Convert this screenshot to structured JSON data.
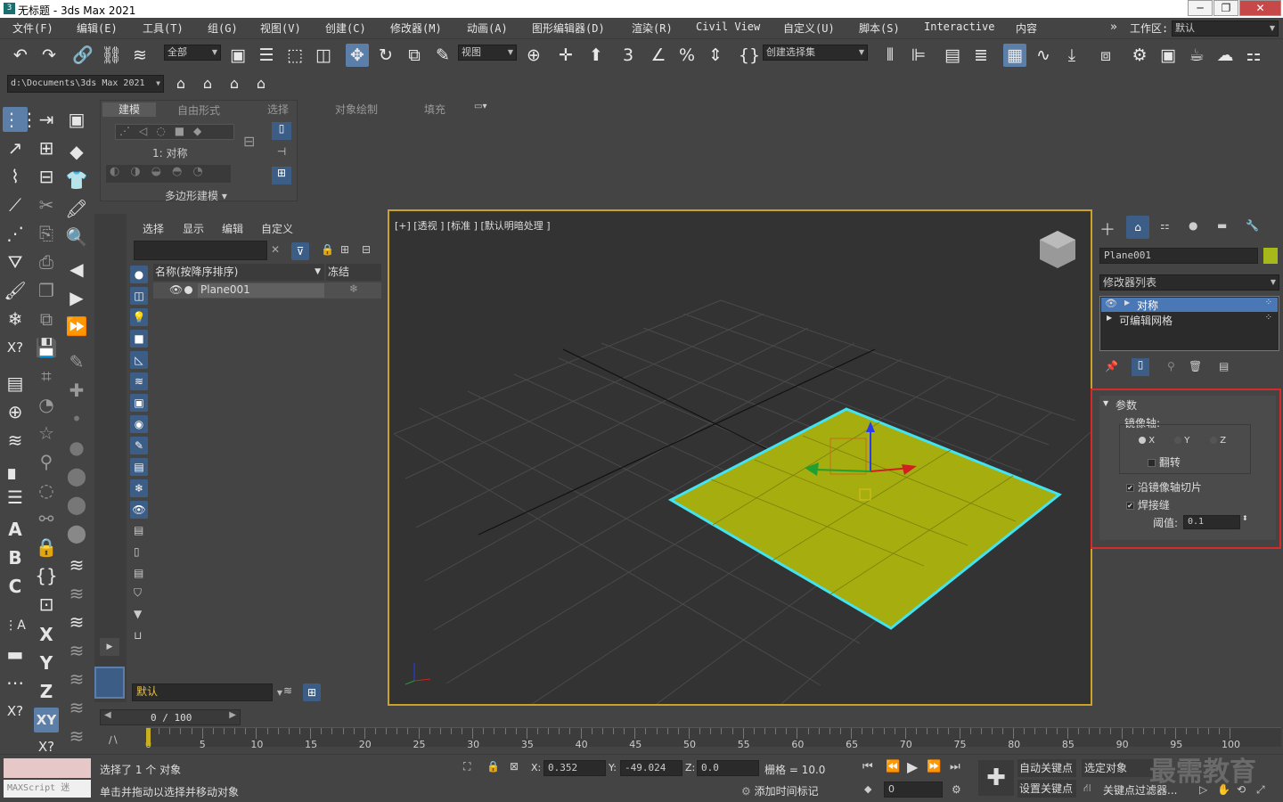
{
  "window": {
    "app_icon": "3dsmax-logo-icon",
    "title": "无标题 - 3ds Max 2021",
    "buttons": [
      "─",
      "❐",
      "✕"
    ]
  },
  "menu": [
    "文件(F)",
    "编辑(E)",
    "工具(T)",
    "组(G)",
    "视图(V)",
    "创建(C)",
    "修改器(M)",
    "动画(A)",
    "图形编辑器(D)",
    "渲染(R)",
    "Civil View",
    "自定义(U)",
    "脚本(S)",
    "Interactive",
    "内容"
  ],
  "workspace": {
    "label": "工作区:",
    "value": "默认"
  },
  "toolbar": {
    "filter": "全部",
    "ref_coord": "视图",
    "selection_set": "创建选择集"
  },
  "project_path": "d:\\Documents\\3ds Max 2021",
  "ribbon": {
    "tabs": [
      "建模",
      "自由形式",
      "选择",
      "对象绘制",
      "填充"
    ],
    "mode_label": "1: 对称",
    "panel_label": "多边形建模"
  },
  "scene_explorer": {
    "menus": [
      "选择",
      "显示",
      "编辑",
      "自定义"
    ],
    "columns": [
      "名称(按降序排序)",
      "冻结"
    ],
    "rows": [
      {
        "name": "Plane001"
      }
    ],
    "layer": "默认"
  },
  "viewport": {
    "label": "[+] [透视 ] [标准 ] [默认明暗处理 ]",
    "accent": "#c9a227"
  },
  "command_panel": {
    "object_name": "Plane001",
    "object_color": "#a6b81a",
    "modifier_list": "修改器列表",
    "stack": [
      {
        "name": "对称",
        "selected": true
      },
      {
        "name": "可编辑网格",
        "selected": false
      }
    ]
  },
  "params": {
    "title": "参数",
    "mirror_axis_label": "镜像轴:",
    "axes": [
      "X",
      "Y",
      "Z"
    ],
    "selected_axis": "X",
    "flip_label": "翻转",
    "flip": false,
    "slice_label": "沿镜像轴切片",
    "slice": true,
    "weld_label": "焊接缝",
    "weld": true,
    "threshold_label": "阈值:",
    "threshold": "0.1",
    "highlight": "#d62b2b"
  },
  "timeline": {
    "frame_display": "0 / 100",
    "ticks": [
      "0",
      "5",
      "10",
      "15",
      "20",
      "25",
      "30",
      "35",
      "40",
      "45",
      "50",
      "55",
      "60",
      "65",
      "70",
      "75",
      "80",
      "85",
      "90",
      "95",
      "100"
    ]
  },
  "status": {
    "maxscript": "MAXScript 迷",
    "selected": "选择了 1 个 对象",
    "hint": "单击并拖动以选择并移动对象",
    "x_label": "X:",
    "x": "0.352",
    "y_label": "Y:",
    "y": "-49.024",
    "z_label": "Z:",
    "z": "0.0",
    "grid": "栅格 = 10.0",
    "add_time_tag": "添加时间标记",
    "frame": "0",
    "auto_key": "自动关键点",
    "selected_object": "选定对象",
    "set_key": "设置关键点",
    "key_filter": "关键点过滤器...",
    "watermark": "最需教育"
  }
}
